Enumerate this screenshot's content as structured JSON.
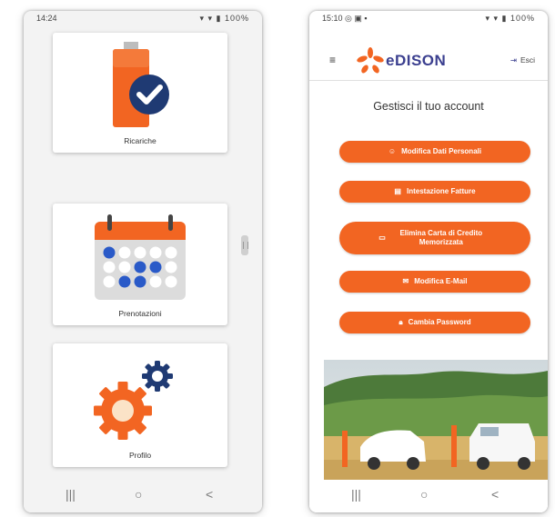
{
  "left_phone": {
    "status": {
      "left": "14:24",
      "right": "▾ ▾ ▮ 100%"
    },
    "cards": [
      {
        "label": "Ricariche",
        "icon": "battery-check-icon"
      },
      {
        "label": "Prenotazioni",
        "icon": "calendar-icon"
      },
      {
        "label": "Profilo",
        "icon": "gears-icon"
      }
    ],
    "nav": {
      "recent": "|||",
      "home": "○",
      "back": "<"
    }
  },
  "right_phone": {
    "status": {
      "left": "15:10 ◎ ▣ ▪",
      "right": "▾ ▾ ▮ 100%"
    },
    "header": {
      "menu": "≡",
      "logo_text": "eDISON",
      "exit_label": "Esci"
    },
    "title": "Gestisci il tuo account",
    "buttons": [
      {
        "label": "Modifica Dati Personali",
        "icon": "user-icon"
      },
      {
        "label": "Intestazione Fatture",
        "icon": "invoice-icon"
      },
      {
        "label": "Elimina Carta di Credito Memorizzata",
        "icon": "credit-card-icon"
      },
      {
        "label": "Modifica E-Mail",
        "icon": "mail-icon"
      },
      {
        "label": "Cambia Password",
        "icon": "lock-icon"
      }
    ],
    "nav": {
      "recent": "|||",
      "home": "○",
      "back": "<"
    }
  },
  "colors": {
    "accent": "#f26522",
    "brand_blue": "#3b3f8f",
    "navy": "#1f3a73",
    "calendar_blue": "#2a5ac8"
  }
}
